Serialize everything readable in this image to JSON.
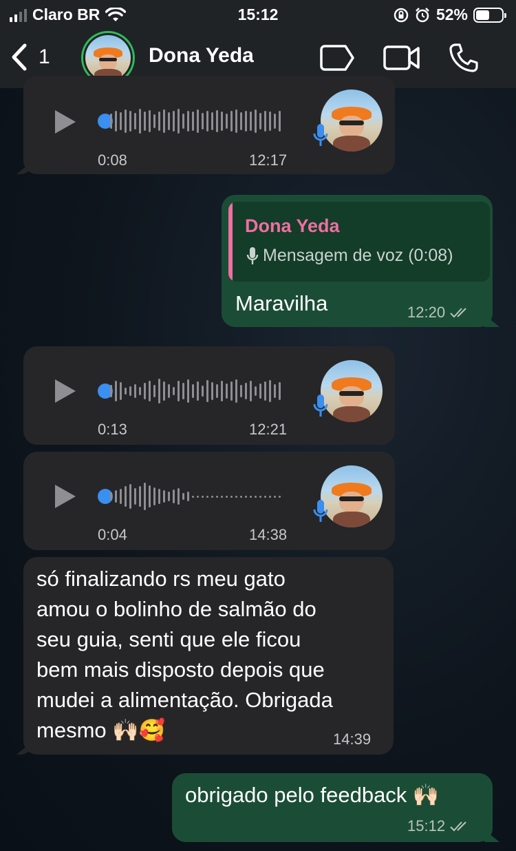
{
  "status_bar": {
    "carrier": "Claro BR",
    "time": "15:12",
    "battery": "52%",
    "battery_level": 0.52
  },
  "header": {
    "back_count": "1",
    "contact_name": "Dona Yeda"
  },
  "messages": {
    "voice1": {
      "duration": "0:08",
      "time": "12:17"
    },
    "reply1": {
      "quoted_name": "Dona Yeda",
      "quoted_text": "Mensagem de voz (0:08)",
      "text": "Maravilha",
      "time": "12:20"
    },
    "voice2": {
      "duration": "0:13",
      "time": "12:21"
    },
    "voice3": {
      "duration": "0:04",
      "time": "14:38"
    },
    "text1": {
      "lines": [
        "só finalizando rs meu gato",
        "amou o bolinho de salmão do",
        "seu guia, senti que ele ficou",
        "bem mais disposto depois que",
        "mudei a alimentação. Obrigada",
        "mesmo 🙌🏻🥰"
      ],
      "time": "14:39"
    },
    "reply2": {
      "text": "obrigado pelo feedback 🙌🏻",
      "time": "15:12"
    }
  },
  "icons": {
    "back": "chevron-left-icon",
    "label": "tag-icon",
    "video": "video-camera-icon",
    "call": "phone-icon",
    "play": "play-icon",
    "mic": "microphone-icon",
    "read": "double-check-icon"
  },
  "colors": {
    "incoming_bubble": "#262628",
    "outgoing_bubble": "#1b4d36",
    "accent_blue": "#3a8ff0",
    "quote_name": "#ef6fa0",
    "online_ring": "#2fbd5a"
  }
}
